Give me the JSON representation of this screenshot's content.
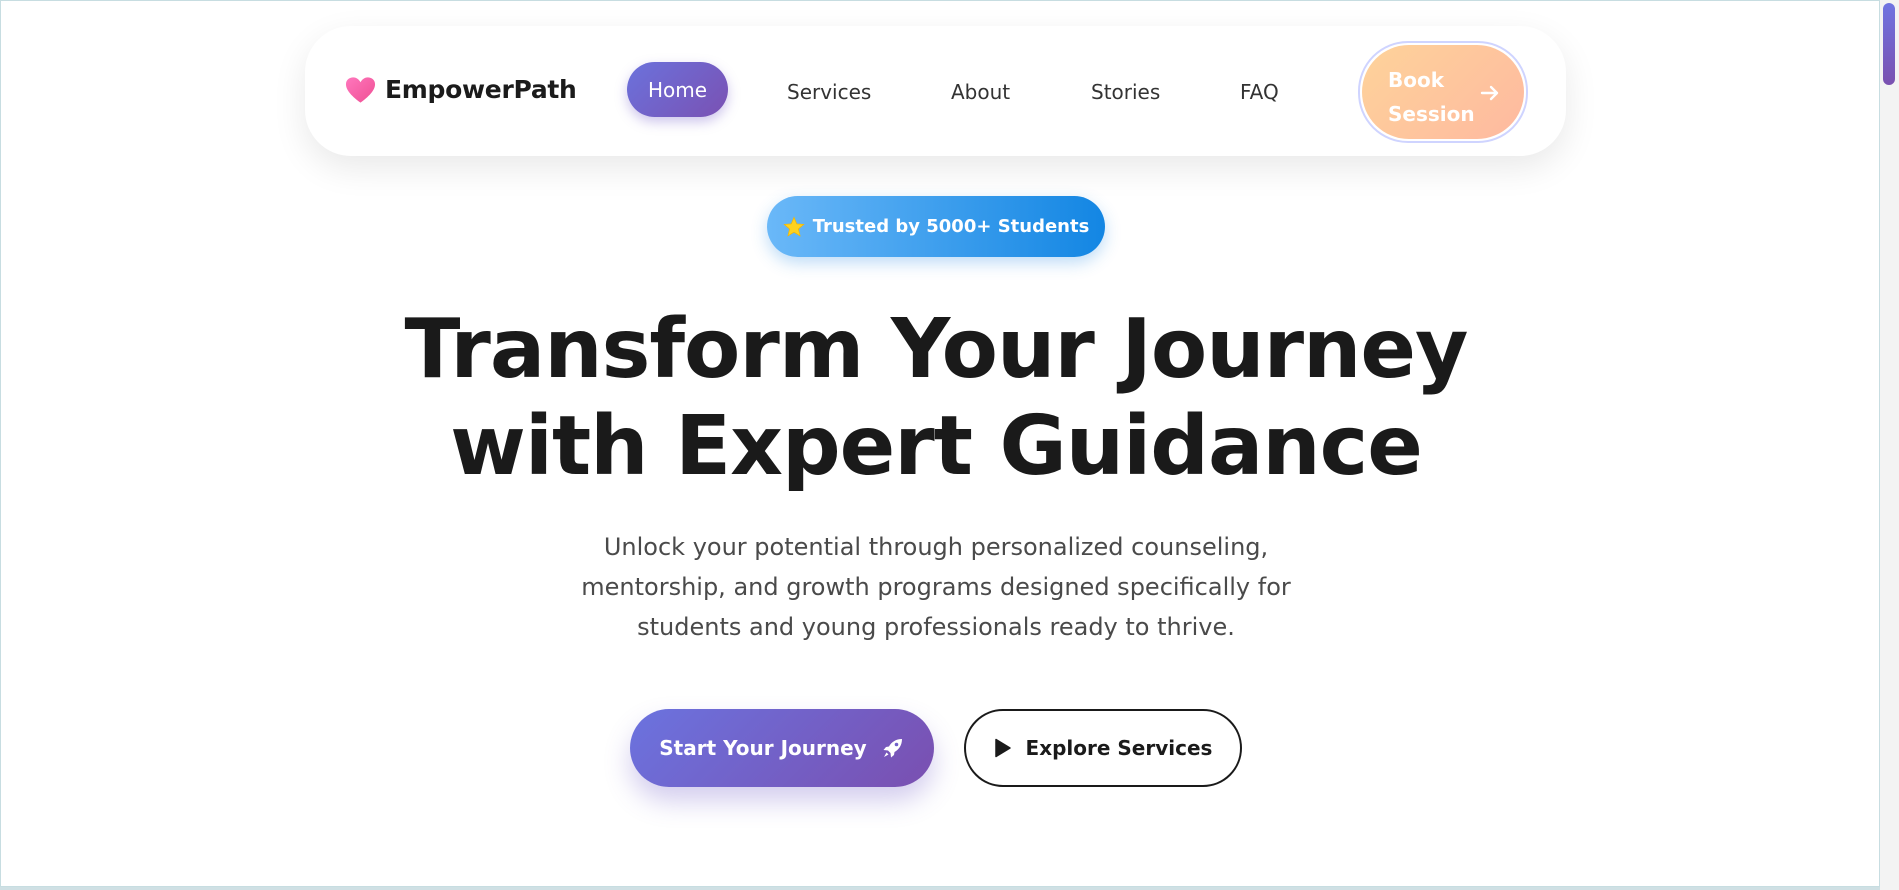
{
  "nav": {
    "brand": "EmpowerPath",
    "brand_icon": "heart-icon",
    "items": [
      {
        "label": "Home",
        "active": true
      },
      {
        "label": "Services"
      },
      {
        "label": "About"
      },
      {
        "label": "Stories"
      },
      {
        "label": "FAQ"
      }
    ],
    "cta": {
      "label": "Book Session",
      "icon": "arrow-right-icon"
    }
  },
  "hero": {
    "badge": {
      "text": "Trusted by 5000+ Students",
      "icon": "star-icon"
    },
    "title_line1": "Transform Your Journey",
    "title_line2": "with Expert Guidance",
    "subtitle": "Unlock your potential through personalized counseling, mentorship, and growth programs designed specifically for students and young professionals ready to thrive.",
    "primary_button": {
      "label": "Start Your Journey",
      "icon": "rocket-icon"
    },
    "secondary_button": {
      "label": "Explore Services",
      "icon": "play-icon"
    }
  },
  "colors": {
    "primary_gradient_start": "#6b73df",
    "primary_gradient_end": "#7a4fb0",
    "cta_gradient_start": "#fed39a",
    "cta_gradient_end": "#feb9a0",
    "badge_gradient_start": "#6ab8f8",
    "badge_gradient_end": "#1386e3",
    "heart": "#f15ba5",
    "text_dark": "#1a1a1a"
  }
}
